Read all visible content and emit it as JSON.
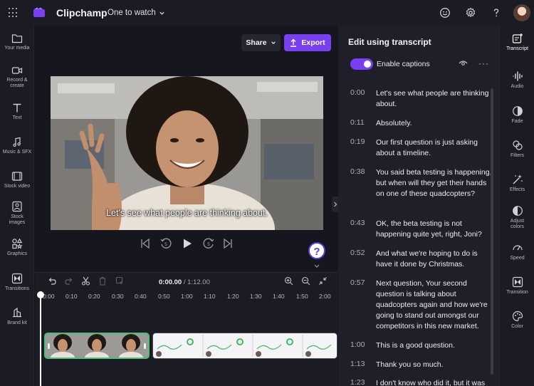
{
  "app": {
    "title": "Clipchamp",
    "project_name": "One to watch"
  },
  "left_sidebar": {
    "items": [
      {
        "label": "Your media",
        "icon": "folder-icon"
      },
      {
        "label": "Record & create",
        "icon": "camera-icon"
      },
      {
        "label": "Text",
        "icon": "text-icon"
      },
      {
        "label": "Music & SFX",
        "icon": "music-icon"
      },
      {
        "label": "Stock video",
        "icon": "film-icon"
      },
      {
        "label": "Stock images",
        "icon": "image-icon"
      },
      {
        "label": "Graphics",
        "icon": "shapes-icon"
      },
      {
        "label": "Transitions",
        "icon": "transitions-icon"
      },
      {
        "label": "Brand kit",
        "icon": "brand-kit-icon"
      }
    ]
  },
  "toolbar": {
    "share_label": "Share",
    "export_label": "Export"
  },
  "preview": {
    "caption": "Let's see what people are thinking about."
  },
  "help": {
    "label": "?"
  },
  "timeline": {
    "current_time": "0:00.00",
    "separator": " / ",
    "total_time": "1:12.00",
    "ticks": [
      "0:00",
      "0:10",
      "0:20",
      "0:30",
      "0:40",
      "0:50",
      "1:00",
      "1:10",
      "1:20",
      "1:30",
      "1:40",
      "1:50",
      "2:00"
    ]
  },
  "transcript": {
    "title": "Edit using transcript",
    "captions_label": "Enable captions",
    "captions_enabled": true,
    "more_label": "···",
    "entries": [
      {
        "time": "0:00",
        "text": "Let's see what people are thinking about."
      },
      {
        "time": "0:11",
        "text": "Absolutely."
      },
      {
        "time": "0:19",
        "text": "Our first question is just asking about a timeline."
      },
      {
        "time": "0:38",
        "text": "You said beta testing is happening, but when will they get their hands on one of these quadcopters?"
      },
      {
        "time": "0:43",
        "text": "OK, the beta testing is not happening quite yet, right, Joni?"
      },
      {
        "time": "0:52",
        "text": "And what we're hoping to do is have it done by Christmas."
      },
      {
        "time": "0:57",
        "text": "Next question, Your second question is talking about quadcopters again and how we're going to stand out amongst our competitors in this new market."
      },
      {
        "time": "1:00",
        "text": "This is a good question."
      },
      {
        "time": "1:13",
        "text": "Thank you so much."
      },
      {
        "time": "1:23",
        "text": "I don't know who did it, but it was"
      }
    ]
  },
  "right_rail": {
    "items": [
      {
        "label": "Transcript",
        "icon": "transcript-icon",
        "active": true
      },
      {
        "label": "Audio",
        "icon": "audio-icon"
      },
      {
        "label": "Fade",
        "icon": "fade-icon"
      },
      {
        "label": "Filters",
        "icon": "filters-icon"
      },
      {
        "label": "Effects",
        "icon": "effects-icon"
      },
      {
        "label": "Adjust colors",
        "icon": "adjust-colors-icon"
      },
      {
        "label": "Speed",
        "icon": "speed-icon"
      },
      {
        "label": "Transition",
        "icon": "transition-icon"
      },
      {
        "label": "Color",
        "icon": "color-icon"
      }
    ]
  },
  "colors": {
    "accent": "#7a3ff2",
    "clip_selected": "#4fc07a",
    "background": "#16161f"
  }
}
